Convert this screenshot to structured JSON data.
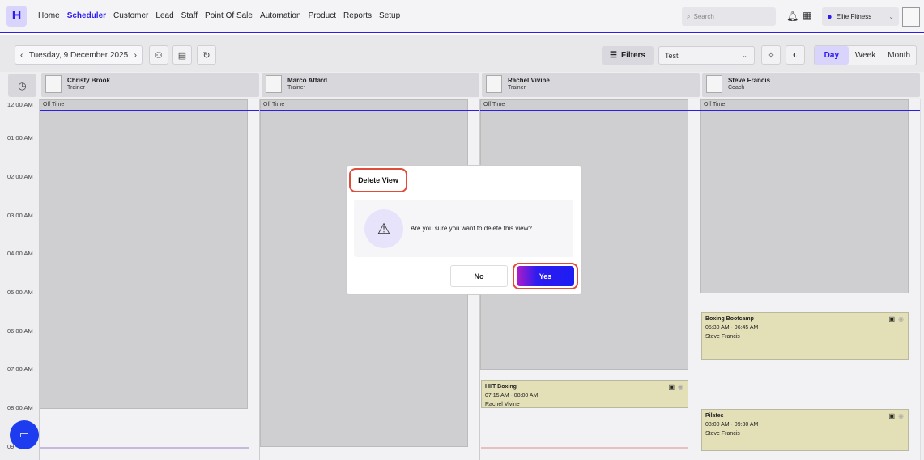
{
  "app": {
    "logo_letter": "H"
  },
  "nav": {
    "items": [
      "Home",
      "Scheduler",
      "Customer",
      "Lead",
      "Staff",
      "Point Of Sale",
      "Automation",
      "Product",
      "Reports",
      "Setup"
    ],
    "active": "Scheduler",
    "search_placeholder": "Search",
    "location": "Elite Fitness"
  },
  "toolbar": {
    "date": "Tuesday, 9 December 2025",
    "filters_label": "Filters",
    "selected_view": "Test",
    "view_modes": [
      "Day",
      "Week",
      "Month"
    ],
    "active_mode": "Day"
  },
  "staff": [
    {
      "name": "Christy Brook",
      "role": "Trainer"
    },
    {
      "name": "Marco Attard",
      "role": "Trainer"
    },
    {
      "name": "Rachel Vivine",
      "role": "Trainer"
    },
    {
      "name": "Steve Francis",
      "role": "Coach"
    }
  ],
  "time_slots": [
    "12:00 AM",
    "01:00 AM",
    "02:00 AM",
    "03:00 AM",
    "04:00 AM",
    "05:00 AM",
    "06:00 AM",
    "07:00 AM",
    "08:00 AM",
    "09"
  ],
  "off_time_label": "Off Time",
  "events": [
    {
      "title": "Boxing Bootcamp",
      "time": "05:30 AM - 06:45 AM",
      "staff": "Steve Francis"
    },
    {
      "title": "HIIT Boxing",
      "time": "07:15 AM - 08:00 AM",
      "staff": "Rachel Vivine"
    },
    {
      "title": "Pilates",
      "time": "08:00 AM - 09:30 AM",
      "staff": "Steve Francis"
    }
  ],
  "dialog": {
    "title": "Delete View",
    "message": "Are you sure you want to delete this view?",
    "no_label": "No",
    "yes_label": "Yes"
  },
  "colors": {
    "accent": "#2d1cf0",
    "highlight": "#e04b3a",
    "event_fill": "#e3e0b8",
    "offtime_fill": "#cfcfd1"
  }
}
